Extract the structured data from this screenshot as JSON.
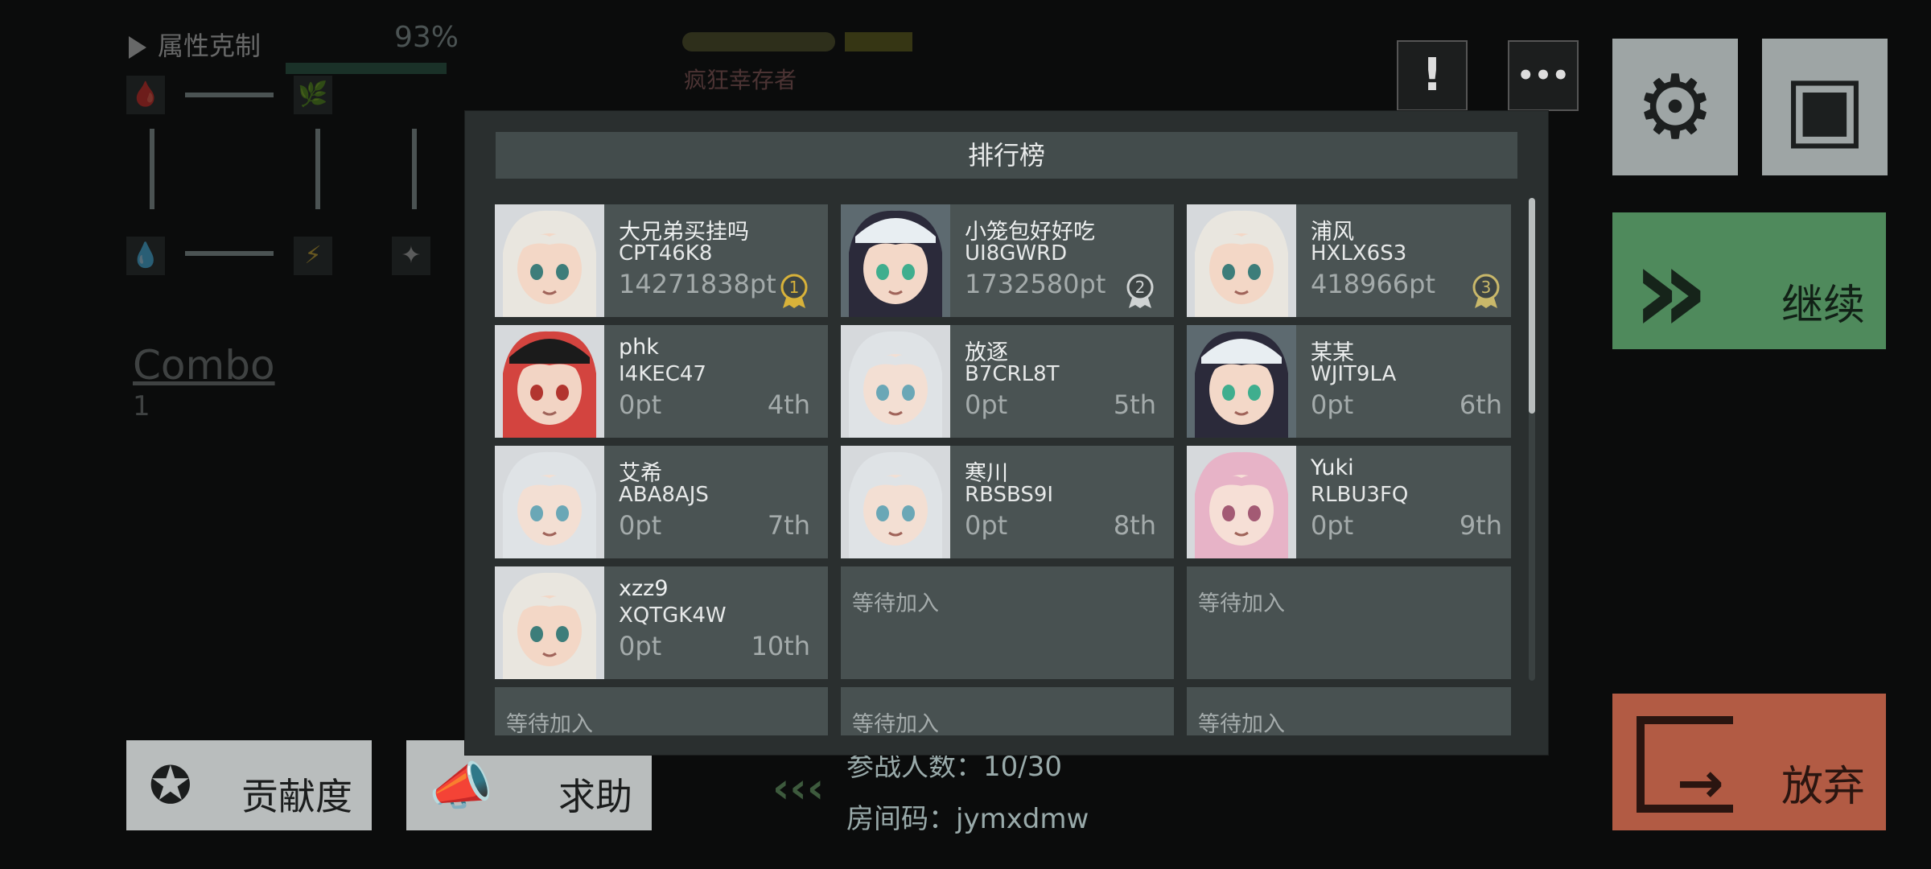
{
  "hud": {
    "attribute_title": "属性克制",
    "percent": "93%",
    "combo_label": "Combo",
    "combo_value": "1",
    "boss_name": "疯狂幸存者",
    "elements": [
      "🩸",
      "🌿",
      "💧",
      "⚡",
      "✦"
    ],
    "participants_label": "参战人数：",
    "participants_value": "10/30",
    "room_code_label": "房间码：",
    "room_code_value": "jymxdmw"
  },
  "buttons": {
    "continue_label": "继续",
    "give_up_label": "放弃",
    "contribution_label": "贡献度",
    "help_label": "求助",
    "alert_icon": "!",
    "chat_icon": "•••"
  },
  "leaderboard": {
    "title": "排行榜",
    "waiting_text": "等待加入",
    "entries": [
      {
        "name": "大兄弟买挂吗",
        "code": "CPT46K8",
        "score": "14271838pt",
        "rank": "1",
        "medal": "gold",
        "avatar": "white-hair"
      },
      {
        "name": "小笼包好好吃",
        "code": "UI8GWRD",
        "score": "1732580pt",
        "rank": "2",
        "medal": "silver",
        "avatar": "dark-hair-cap"
      },
      {
        "name": "浦风",
        "code": "HXLX6S3",
        "score": "418966pt",
        "rank": "3",
        "medal": "bronze",
        "avatar": "white-hair"
      },
      {
        "name": "phk",
        "code": "I4KEC47",
        "score": "0pt",
        "rank": "4th",
        "avatar": "red-hair-cap"
      },
      {
        "name": "放逐",
        "code": "B7CRL8T",
        "score": "0pt",
        "rank": "5th",
        "avatar": "silver-hair"
      },
      {
        "name": "某某",
        "code": "WJIT9LA",
        "score": "0pt",
        "rank": "6th",
        "avatar": "dark-hair-cap"
      },
      {
        "name": "艾希",
        "code": "ABA8AJS",
        "score": "0pt",
        "rank": "7th",
        "avatar": "silver-hair"
      },
      {
        "name": "寒川",
        "code": "RBSBS9I",
        "score": "0pt",
        "rank": "8th",
        "avatar": "silver-hair"
      },
      {
        "name": "Yuki",
        "code": "RLBU3FQ",
        "score": "0pt",
        "rank": "9th",
        "avatar": "pink-hair"
      },
      {
        "name": "xzz9",
        "code": "XQTGK4W",
        "score": "0pt",
        "rank": "10th",
        "avatar": "white-hair"
      }
    ],
    "empty_slots": 5
  },
  "colors": {
    "continue": "#4f8a5c",
    "give_up": "#b25b44",
    "gold_medal": "#d8b23a",
    "silver_medal": "#cfd3d3",
    "bronze_medal": "#c9b86a"
  }
}
